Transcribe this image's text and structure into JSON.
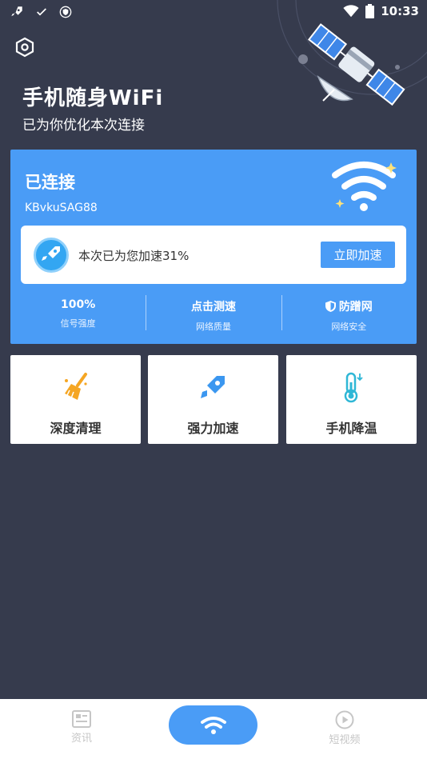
{
  "status_bar": {
    "time": "10:33"
  },
  "header": {
    "title": "手机随身WiFi",
    "subtitle": "已为你优化本次连接"
  },
  "card": {
    "status": "已连接",
    "ssid": "KBvkuSAG88",
    "boost_text": "本次已为您加速31%",
    "boost_button": "立即加速",
    "stats": [
      {
        "value": "100%",
        "label": "信号强度"
      },
      {
        "value": "点击测速",
        "label": "网络质量"
      },
      {
        "value": "防蹭网",
        "label": "网络安全",
        "icon": "shield-icon"
      }
    ]
  },
  "tools": [
    {
      "label": "深度清理",
      "icon": "broom-icon"
    },
    {
      "label": "强力加速",
      "icon": "rocket-icon"
    },
    {
      "label": "手机降温",
      "icon": "thermometer-icon"
    }
  ],
  "bottom_nav": {
    "items": [
      {
        "label": "资讯",
        "icon": "news-icon"
      },
      {
        "label": "",
        "icon": "wifi-icon"
      },
      {
        "label": "短视频",
        "icon": "play-icon"
      }
    ]
  },
  "colors": {
    "background": "#363b4d",
    "accent": "#4a9cf6",
    "card_white": "#ffffff",
    "orange": "#f5a623"
  }
}
